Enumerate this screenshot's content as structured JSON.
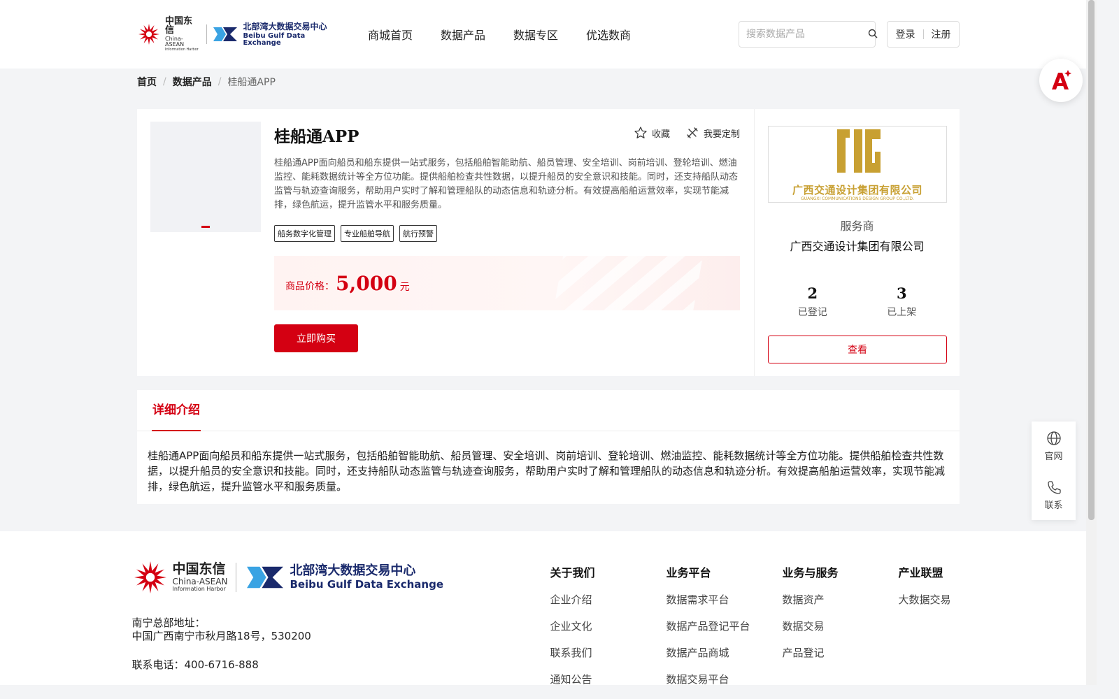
{
  "header": {
    "logo": {
      "cn_name": "中国东信",
      "cn_en": "China-ASEAN",
      "cn_sub": "Information Harbor",
      "bb_cn": "北部湾大数据交易中心",
      "bb_en": "Beibu Gulf Data Exchange"
    },
    "nav": [
      "商城首页",
      "数据产品",
      "数据专区",
      "优选数商"
    ],
    "search": {
      "placeholder": "搜索数据产品",
      "value": ""
    },
    "auth": {
      "login": "登录",
      "register": "注册"
    }
  },
  "breadcrumb": {
    "home": "首页",
    "category": "数据产品",
    "current": "桂船通APP"
  },
  "product": {
    "title": "桂船通APP",
    "actions": {
      "favorite": "收藏",
      "customize": "我要定制"
    },
    "description": "桂船通APP面向船员和船东提供一站式服务，包括船舶智能助航、船员管理、安全培训、岗前培训、登轮培训、燃油监控、能耗数据统计等全方位功能。提供船舶检查共性数据，以提升船员的安全意识和技能。同时，还支持船队动态监管与轨迹查询服务，帮助用户实时了解和管理船队的动态信息和轨迹分析。有效提高船舶运营效率，实现节能减排，绿色航运，提升监管水平和服务质量。",
    "tags": [
      "船务数字化管理",
      "专业船舶导航",
      "航行预警"
    ],
    "price": {
      "label": "商品价格：",
      "value": "5,000",
      "unit": "元"
    },
    "buy_label": "立即购买"
  },
  "vendor": {
    "logo_text": "广西交通设计集团有限公司",
    "logo_en": "GUANGXI COMMUNICATIONS DESIGN GROUP CO.,LTD.",
    "role": "服务商",
    "name": "广西交通设计集团有限公司",
    "stats": [
      {
        "num": "2",
        "label": "已登记"
      },
      {
        "num": "3",
        "label": "已上架"
      }
    ],
    "view_label": "查看"
  },
  "details": {
    "tab": "详细介绍",
    "text": "桂船通APP面向船员和船东提供一站式服务，包括船舶智能助航、船员管理、安全培训、岗前培训、登轮培训、燃油监控、能耗数据统计等全方位功能。提供船舶检查共性数据，以提升船员的安全意识和技能。同时，还支持船队动态监管与轨迹查询服务，帮助用户实时了解和管理船队的动态信息和轨迹分析。有效提高船舶运营效率，实现节能减排，绿色航运，提升监管水平和服务质量。"
  },
  "footer": {
    "address_label": "南宁总部地址：",
    "address": "中国广西南宁市秋月路18号，530200",
    "phone": "联系电话：400-6716-888",
    "columns": [
      {
        "title": "关于我们",
        "items": [
          "企业介绍",
          "企业文化",
          "联系我们",
          "通知公告"
        ]
      },
      {
        "title": "业务平台",
        "items": [
          "数据需求平台",
          "数据产品登记平台",
          "数据产品商城",
          "数据交易平台"
        ]
      },
      {
        "title": "业务与服务",
        "items": [
          "数据资产",
          "数据交易",
          "产品登记"
        ]
      },
      {
        "title": "产业联盟",
        "items": [
          "大数据交易"
        ]
      }
    ]
  },
  "side_tools": {
    "website": "官网",
    "contact": "联系"
  },
  "colors": {
    "brand_red": "#d40012",
    "gold": "#c8a032",
    "navy": "#1a2a6c"
  }
}
